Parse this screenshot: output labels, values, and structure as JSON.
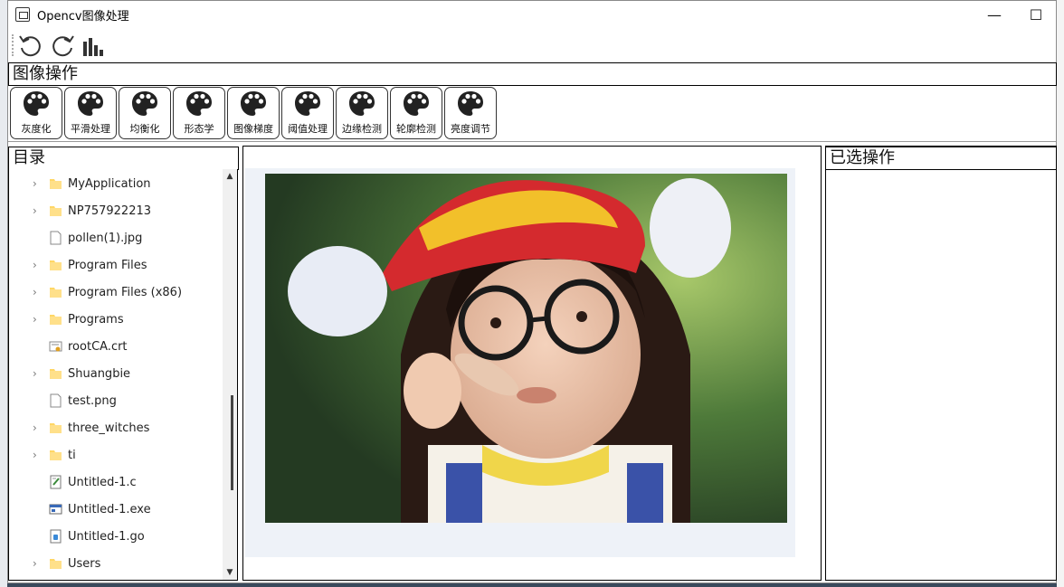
{
  "window": {
    "title": "Opencv图像处理",
    "controls": {
      "minimize": "—",
      "maximize": "☐",
      "close": "✕"
    }
  },
  "toolbar": {
    "buttons": [
      {
        "icon": "undo-icon"
      },
      {
        "icon": "redo-icon"
      },
      {
        "icon": "histogram-icon"
      }
    ]
  },
  "operations": {
    "title": "图像操作",
    "buttons": [
      {
        "label": "灰度化",
        "icon": "palette-icon"
      },
      {
        "label": "平滑处理",
        "icon": "palette-icon"
      },
      {
        "label": "均衡化",
        "icon": "palette-icon"
      },
      {
        "label": "形态学",
        "icon": "palette-icon"
      },
      {
        "label": "图像梯度",
        "icon": "palette-icon"
      },
      {
        "label": "阈值处理",
        "icon": "palette-icon"
      },
      {
        "label": "边缘检测",
        "icon": "palette-icon"
      },
      {
        "label": "轮廓检测",
        "icon": "palette-icon"
      },
      {
        "label": "亮度调节",
        "icon": "palette-icon"
      }
    ]
  },
  "directory": {
    "title": "目录",
    "items": [
      {
        "name": "MyApplication",
        "type": "folder",
        "expandable": true
      },
      {
        "name": "NP757922213",
        "type": "folder",
        "expandable": true
      },
      {
        "name": "pollen(1).jpg",
        "type": "file",
        "expandable": false
      },
      {
        "name": "Program Files",
        "type": "folder",
        "expandable": true
      },
      {
        "name": "Program Files (x86)",
        "type": "folder",
        "expandable": true
      },
      {
        "name": "Programs",
        "type": "folder",
        "expandable": true
      },
      {
        "name": "rootCA.crt",
        "type": "certificate",
        "expandable": false
      },
      {
        "name": "Shuangbie",
        "type": "folder",
        "expandable": true
      },
      {
        "name": "test.png",
        "type": "file",
        "expandable": false
      },
      {
        "name": "three_witches",
        "type": "folder",
        "expandable": true
      },
      {
        "name": "ti",
        "type": "folder",
        "expandable": true
      },
      {
        "name": "Untitled-1.c",
        "type": "c-source",
        "expandable": false
      },
      {
        "name": "Untitled-1.exe",
        "type": "executable",
        "expandable": false
      },
      {
        "name": "Untitled-1.go",
        "type": "go-source",
        "expandable": false
      },
      {
        "name": "Users",
        "type": "folder",
        "expandable": true
      }
    ]
  },
  "selected_ops": {
    "title": "已选操作",
    "items": []
  },
  "colors": {
    "folder": "#ffd766",
    "canvas_bg": "#eef2f8",
    "border": "#000000"
  }
}
